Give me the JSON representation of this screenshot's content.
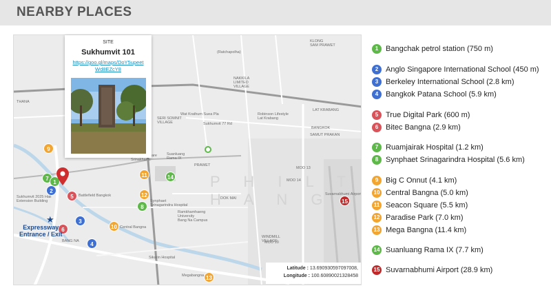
{
  "header": {
    "title": "NEARBY PLACES"
  },
  "colors": {
    "green": "#5fb84a",
    "blue": "#3e6fd1",
    "red": "#d9545a",
    "orange": "#f2a531",
    "darkred": "#c02a2a",
    "header_bg": "#e6e6e6"
  },
  "popup": {
    "label": "SITE",
    "title": "Sukhumvit 101",
    "link": "https://goo.gl/maps/DoY5upeetWd8EZcY8",
    "link_display": "https://goo.gl/maps/DoY5upeetWd8EZcY8"
  },
  "map": {
    "expressway_label": "Expressway\nEntrance / Exit",
    "latitude_label": "Latitude :",
    "latitude_value": "13.690930597097008,",
    "longitude_label": "Longitude :",
    "longitude_value": "100.60890021328458",
    "labels": [
      "(Ratchapolha)",
      "KLONG\nSAM PRAWET",
      "LAT KRABANG",
      "BANGKOK",
      "SAMUT PRAKAN",
      "THANA",
      "Sukhumvit 77 Rd",
      "Wat Krathum Suea Pla",
      "NAKKILA\nLIMITED\nVILLAGE",
      "Robinson Lifestyle\nLat Krabang",
      "SERI SOMNIT\nVILLAGE",
      "PRAWET",
      "DOK MAI",
      "Seacon Square\nSrinakharin",
      "Synphaet\nSrinagarindra Hospital",
      "Central Bangna",
      "BANG NA",
      "Suvarnabhumi Airport",
      "MOO 14",
      "MOO 10",
      "MOO 13",
      "WINDMILL\nVILLAGE",
      "Sikarin Hospital",
      "Megabangna",
      "Sukhumvit 2025 Hall\nExtension Building",
      "Battlefield Bangkok",
      "Suanluang\nRama IX",
      "Ramkhamhaeng\nUniversity\nBang Na Campus"
    ],
    "watermark": "P H I L T H A N G",
    "markers": [
      {
        "num": "9",
        "color": "#f2a531"
      },
      {
        "num": "7",
        "color": "#5fb84a"
      },
      {
        "num": "1",
        "color": "#5fb84a"
      },
      {
        "num": "2",
        "color": "#3e6fd1"
      },
      {
        "num": "5",
        "color": "#d9545a"
      },
      {
        "num": "6",
        "color": "#d9545a"
      },
      {
        "num": "3",
        "color": "#3e6fd1"
      },
      {
        "num": "4",
        "color": "#3e6fd1"
      },
      {
        "num": "14",
        "color": "#5fb84a"
      },
      {
        "num": "11",
        "color": "#f2a531"
      },
      {
        "num": "12",
        "color": "#f2a531"
      },
      {
        "num": "8",
        "color": "#5fb84a"
      },
      {
        "num": "10",
        "color": "#f2a531"
      },
      {
        "num": "13",
        "color": "#f2a531"
      },
      {
        "num": "15",
        "color": "#c02a2a"
      }
    ]
  },
  "places": [
    {
      "num": "1",
      "label": "Bangchak petrol station (750 m)",
      "color": "#5fb84a"
    },
    {
      "num": "2",
      "label": "Anglo Singapore International School (450 m)",
      "color": "#3e6fd1"
    },
    {
      "num": "3",
      "label": "Berkeley International School (2.8 km)",
      "color": "#3e6fd1"
    },
    {
      "num": "4",
      "label": "Bangkok Patana School (5.9 km)",
      "color": "#3e6fd1"
    },
    {
      "num": "5",
      "label": "True Digital Park (600 m)",
      "color": "#d9545a"
    },
    {
      "num": "6",
      "label": "Bitec Bangna (2.9 km)",
      "color": "#d9545a"
    },
    {
      "num": "7",
      "label": "Ruamjairak Hospital (1.2 km)",
      "color": "#5fb84a"
    },
    {
      "num": "8",
      "label": "Synphaet Srinagarindra Hospital (5.6 km)",
      "color": "#5fb84a"
    },
    {
      "num": "9",
      "label": "Big C Onnut (4.1 km)",
      "color": "#f2a531"
    },
    {
      "num": "10",
      "label": "Central Bangna (5.0 km)",
      "color": "#f2a531"
    },
    {
      "num": "11",
      "label": "Seacon Square (5.5 km)",
      "color": "#f2a531"
    },
    {
      "num": "12",
      "label": "Paradise Park (7.0 km)",
      "color": "#f2a531"
    },
    {
      "num": "13",
      "label": "Mega Bangna (11.4 km)",
      "color": "#f2a531"
    },
    {
      "num": "14",
      "label": "Suanluang Rama IX (7.7 km)",
      "color": "#5fb84a"
    },
    {
      "num": "15",
      "label": "Suvarnabhumi Airport (28.9 km)",
      "color": "#c02a2a"
    }
  ]
}
